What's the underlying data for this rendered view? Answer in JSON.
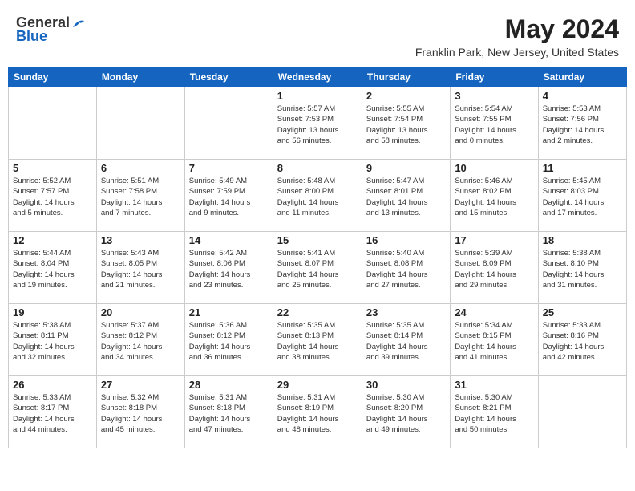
{
  "header": {
    "logo_general": "General",
    "logo_blue": "Blue",
    "month_year": "May 2024",
    "location": "Franklin Park, New Jersey, United States"
  },
  "weekdays": [
    "Sunday",
    "Monday",
    "Tuesday",
    "Wednesday",
    "Thursday",
    "Friday",
    "Saturday"
  ],
  "weeks": [
    [
      {
        "day": "",
        "info": ""
      },
      {
        "day": "",
        "info": ""
      },
      {
        "day": "",
        "info": ""
      },
      {
        "day": "1",
        "info": "Sunrise: 5:57 AM\nSunset: 7:53 PM\nDaylight: 13 hours\nand 56 minutes."
      },
      {
        "day": "2",
        "info": "Sunrise: 5:55 AM\nSunset: 7:54 PM\nDaylight: 13 hours\nand 58 minutes."
      },
      {
        "day": "3",
        "info": "Sunrise: 5:54 AM\nSunset: 7:55 PM\nDaylight: 14 hours\nand 0 minutes."
      },
      {
        "day": "4",
        "info": "Sunrise: 5:53 AM\nSunset: 7:56 PM\nDaylight: 14 hours\nand 2 minutes."
      }
    ],
    [
      {
        "day": "5",
        "info": "Sunrise: 5:52 AM\nSunset: 7:57 PM\nDaylight: 14 hours\nand 5 minutes."
      },
      {
        "day": "6",
        "info": "Sunrise: 5:51 AM\nSunset: 7:58 PM\nDaylight: 14 hours\nand 7 minutes."
      },
      {
        "day": "7",
        "info": "Sunrise: 5:49 AM\nSunset: 7:59 PM\nDaylight: 14 hours\nand 9 minutes."
      },
      {
        "day": "8",
        "info": "Sunrise: 5:48 AM\nSunset: 8:00 PM\nDaylight: 14 hours\nand 11 minutes."
      },
      {
        "day": "9",
        "info": "Sunrise: 5:47 AM\nSunset: 8:01 PM\nDaylight: 14 hours\nand 13 minutes."
      },
      {
        "day": "10",
        "info": "Sunrise: 5:46 AM\nSunset: 8:02 PM\nDaylight: 14 hours\nand 15 minutes."
      },
      {
        "day": "11",
        "info": "Sunrise: 5:45 AM\nSunset: 8:03 PM\nDaylight: 14 hours\nand 17 minutes."
      }
    ],
    [
      {
        "day": "12",
        "info": "Sunrise: 5:44 AM\nSunset: 8:04 PM\nDaylight: 14 hours\nand 19 minutes."
      },
      {
        "day": "13",
        "info": "Sunrise: 5:43 AM\nSunset: 8:05 PM\nDaylight: 14 hours\nand 21 minutes."
      },
      {
        "day": "14",
        "info": "Sunrise: 5:42 AM\nSunset: 8:06 PM\nDaylight: 14 hours\nand 23 minutes."
      },
      {
        "day": "15",
        "info": "Sunrise: 5:41 AM\nSunset: 8:07 PM\nDaylight: 14 hours\nand 25 minutes."
      },
      {
        "day": "16",
        "info": "Sunrise: 5:40 AM\nSunset: 8:08 PM\nDaylight: 14 hours\nand 27 minutes."
      },
      {
        "day": "17",
        "info": "Sunrise: 5:39 AM\nSunset: 8:09 PM\nDaylight: 14 hours\nand 29 minutes."
      },
      {
        "day": "18",
        "info": "Sunrise: 5:38 AM\nSunset: 8:10 PM\nDaylight: 14 hours\nand 31 minutes."
      }
    ],
    [
      {
        "day": "19",
        "info": "Sunrise: 5:38 AM\nSunset: 8:11 PM\nDaylight: 14 hours\nand 32 minutes."
      },
      {
        "day": "20",
        "info": "Sunrise: 5:37 AM\nSunset: 8:12 PM\nDaylight: 14 hours\nand 34 minutes."
      },
      {
        "day": "21",
        "info": "Sunrise: 5:36 AM\nSunset: 8:12 PM\nDaylight: 14 hours\nand 36 minutes."
      },
      {
        "day": "22",
        "info": "Sunrise: 5:35 AM\nSunset: 8:13 PM\nDaylight: 14 hours\nand 38 minutes."
      },
      {
        "day": "23",
        "info": "Sunrise: 5:35 AM\nSunset: 8:14 PM\nDaylight: 14 hours\nand 39 minutes."
      },
      {
        "day": "24",
        "info": "Sunrise: 5:34 AM\nSunset: 8:15 PM\nDaylight: 14 hours\nand 41 minutes."
      },
      {
        "day": "25",
        "info": "Sunrise: 5:33 AM\nSunset: 8:16 PM\nDaylight: 14 hours\nand 42 minutes."
      }
    ],
    [
      {
        "day": "26",
        "info": "Sunrise: 5:33 AM\nSunset: 8:17 PM\nDaylight: 14 hours\nand 44 minutes."
      },
      {
        "day": "27",
        "info": "Sunrise: 5:32 AM\nSunset: 8:18 PM\nDaylight: 14 hours\nand 45 minutes."
      },
      {
        "day": "28",
        "info": "Sunrise: 5:31 AM\nSunset: 8:18 PM\nDaylight: 14 hours\nand 47 minutes."
      },
      {
        "day": "29",
        "info": "Sunrise: 5:31 AM\nSunset: 8:19 PM\nDaylight: 14 hours\nand 48 minutes."
      },
      {
        "day": "30",
        "info": "Sunrise: 5:30 AM\nSunset: 8:20 PM\nDaylight: 14 hours\nand 49 minutes."
      },
      {
        "day": "31",
        "info": "Sunrise: 5:30 AM\nSunset: 8:21 PM\nDaylight: 14 hours\nand 50 minutes."
      },
      {
        "day": "",
        "info": ""
      }
    ]
  ]
}
